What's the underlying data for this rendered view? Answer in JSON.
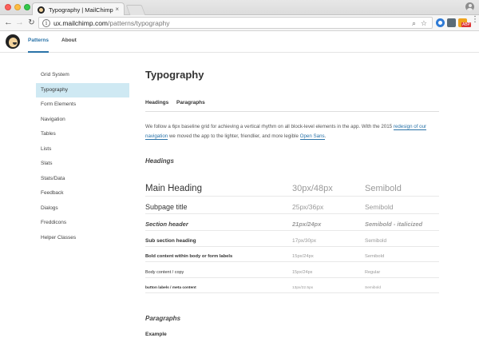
{
  "browser": {
    "tab_title": "Typography | MailChimp",
    "url_host": "ux.mailchimp.com",
    "url_path": "/patterns/typography",
    "extension_badge": "ABP"
  },
  "topnav": [
    {
      "label": "Patterns",
      "active": true
    },
    {
      "label": "About",
      "active": false
    }
  ],
  "sidebar": {
    "items": [
      {
        "label": "Grid System"
      },
      {
        "label": "Typography"
      },
      {
        "label": "Form Elements"
      },
      {
        "label": "Navigation"
      },
      {
        "label": "Tables"
      },
      {
        "label": "Lists"
      },
      {
        "label": "Slats"
      },
      {
        "label": "Stats/Data"
      },
      {
        "label": "Feedback"
      },
      {
        "label": "Dialogs"
      },
      {
        "label": "Freddicons"
      },
      {
        "label": "Helper Classes"
      }
    ],
    "active_index": 1
  },
  "main": {
    "title": "Typography",
    "tabs": [
      {
        "label": "Headings"
      },
      {
        "label": "Paragraphs"
      }
    ],
    "intro": {
      "part1": "We follow a 6px baseline grid for achieving a vertical rhythm on all block-level elements in the app. With the 2015 ",
      "link1": "redesign of our navigation",
      "part2": " we moved the app to the lighter, friendlier, and more legible ",
      "link2": "Open Sans",
      "part3": "."
    },
    "headings_section": "Headings",
    "type_scale": [
      {
        "name": "Main Heading",
        "size": "30px/48px",
        "weight": "Semibold"
      },
      {
        "name": "Subpage title",
        "size": "25px/36px",
        "weight": "Semibold"
      },
      {
        "name": "Section header",
        "size": "21px/24px",
        "weight": "Semibold - italicized"
      },
      {
        "name": "Sub section heading",
        "size": "17px/30px",
        "weight": "Semibold"
      },
      {
        "name": "Bold content within body or form labels",
        "size": "15px/24px",
        "weight": "Semibold"
      },
      {
        "name": "Body content / copy",
        "size": "15px/24px",
        "weight": "Regular"
      },
      {
        "name": "button labels / meta content",
        "size": "13px/22.5px",
        "weight": "Semibold"
      }
    ],
    "paragraphs_section": "Paragraphs",
    "example_label": "Example"
  }
}
